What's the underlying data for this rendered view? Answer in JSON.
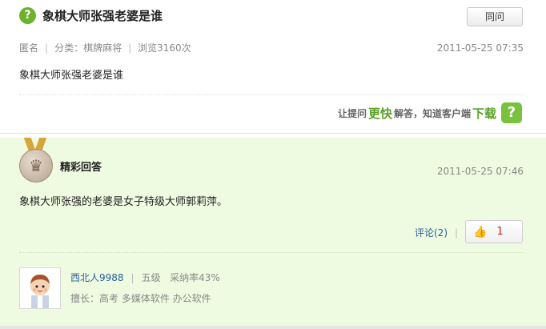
{
  "question": {
    "title": "象棋大师张强老婆是谁",
    "same_button": "同问",
    "author": "匿名",
    "category": "分类：棋牌麻将",
    "views": "浏览3160次",
    "time": "2011-05-25 07:35",
    "body": "象棋大师张强老婆是谁",
    "promo": {
      "prefix": "让提问",
      "highlight": "更快",
      "middle": "解答，知道客户端",
      "download": "下载"
    }
  },
  "answer": {
    "label": "精彩回答",
    "time": "2011-05-25 07:46",
    "body": "象棋大师张强的老婆是女子特级大师郭莉萍。",
    "comment": "评论(2)",
    "likes": "1",
    "user": {
      "name": "西北人9988",
      "level": "五级",
      "adopt_rate": "采纳率43%",
      "skills": "擅长：高考 多媒体软件 办公软件"
    }
  },
  "colors": {
    "accent_green": "#6cb22c",
    "answer_bg": "#eefbe0",
    "link_blue": "#2a5e9a",
    "like_red": "#c4261d"
  }
}
